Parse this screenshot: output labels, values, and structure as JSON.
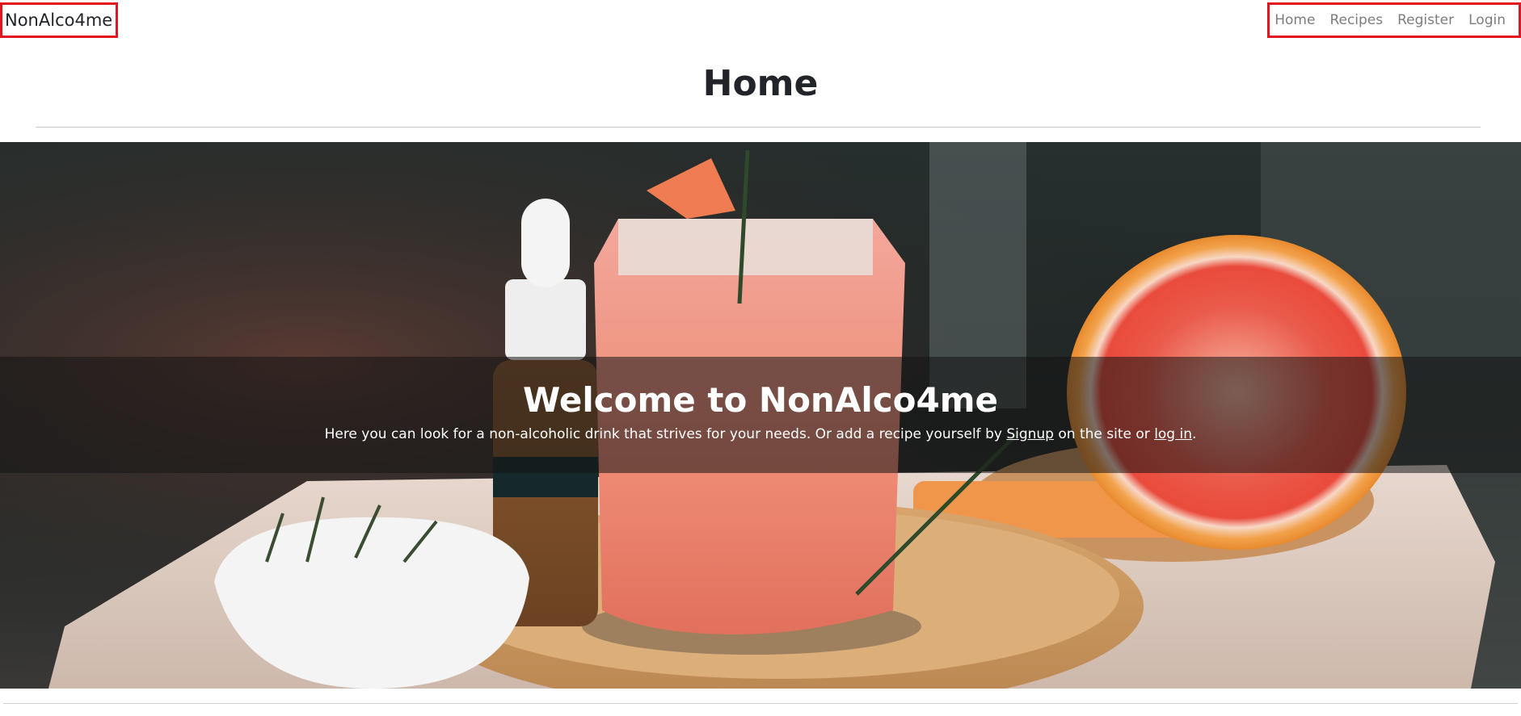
{
  "nav": {
    "brand": "NonAlco4me",
    "links": [
      "Home",
      "Recipes",
      "Register",
      "Login"
    ]
  },
  "page": {
    "title": "Home"
  },
  "hero": {
    "title": "Welcome to NonAlco4me",
    "text_before": "Here you can look for a non-alcoholic drink that strives for your needs. Or add a recipe yourself by ",
    "signup_link": "Signup",
    "text_middle": " on the site or ",
    "login_link": "log in",
    "text_after": ".",
    "image_subject": "pink grapefruit mocktail with rosemary, dropper bottle, grapefruit halves on wooden tray"
  },
  "colors": {
    "highlight_border": "#e3161f",
    "nav_link": "#7d7d7d",
    "text": "#212529"
  }
}
